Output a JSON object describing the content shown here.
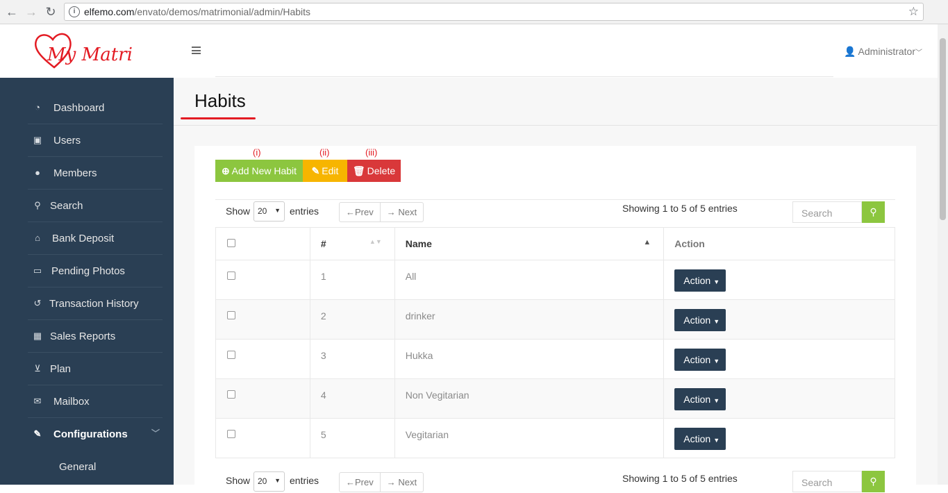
{
  "browser": {
    "url_domain": "elfemo.com",
    "url_path": "/envato/demos/matrimonial/admin/Habits"
  },
  "header": {
    "logo_text": "My Matri",
    "user": "Administrator"
  },
  "sidebar": {
    "items": [
      {
        "label": "Dashboard",
        "icon": "tachometer-icon"
      },
      {
        "label": "Users",
        "icon": "user-lock-icon"
      },
      {
        "label": "Members",
        "icon": "users-icon"
      },
      {
        "label": "Search",
        "icon": "search-icon"
      },
      {
        "label": "Bank Deposit",
        "icon": "bank-icon"
      },
      {
        "label": "Pending Photos",
        "icon": "image-icon"
      },
      {
        "label": "Transaction History",
        "icon": "history-icon"
      },
      {
        "label": "Sales Reports",
        "icon": "table-icon"
      },
      {
        "label": "Plan",
        "icon": "cart-icon"
      },
      {
        "label": "Mailbox",
        "icon": "envelope-icon"
      },
      {
        "label": "Configurations",
        "icon": "wrench-icon"
      }
    ],
    "sub_item": "General"
  },
  "page": {
    "title": "Habits",
    "markers": [
      "(i)",
      "(ii)",
      "(iii)"
    ],
    "buttons": {
      "add": "Add New Habit",
      "edit": "Edit",
      "delete": "Delete"
    },
    "show_label": "Show",
    "page_size": "20",
    "entries_label": "entries",
    "prev": "←Prev",
    "next": "→ Next",
    "info": "Showing 1 to 5 of 5 entries",
    "search_placeholder": "Search"
  },
  "table": {
    "headers": [
      "#",
      "Name",
      "Action"
    ],
    "rows": [
      {
        "num": "1",
        "name": "All"
      },
      {
        "num": "2",
        "name": "drinker"
      },
      {
        "num": "3",
        "name": "Hukka"
      },
      {
        "num": "4",
        "name": "Non Vegitarian"
      },
      {
        "num": "5",
        "name": "Vegitarian"
      }
    ],
    "action_label": "Action"
  },
  "colors": {
    "sidebar": "#2a3f54",
    "add": "#8cc63f",
    "edit": "#f7b500",
    "delete": "#d9383a",
    "accent": "#e31b23"
  }
}
